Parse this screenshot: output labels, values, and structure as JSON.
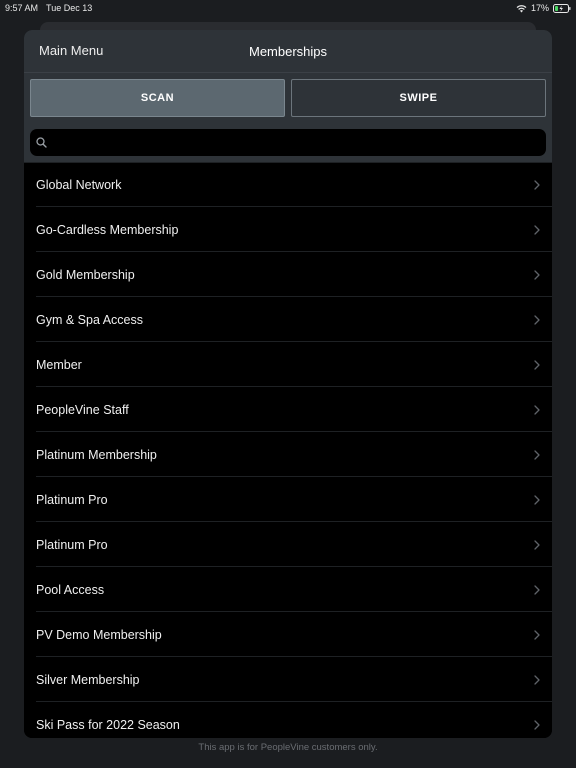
{
  "status_bar": {
    "time": "9:57 AM",
    "date": "Tue Dec 13",
    "battery": "17%"
  },
  "nav": {
    "back_label": "Main Menu",
    "title": "Memberships"
  },
  "segments": {
    "scan_label": "SCAN",
    "swipe_label": "SWIPE",
    "selected": "SCAN"
  },
  "search": {
    "value": "",
    "placeholder": ""
  },
  "list": {
    "items": [
      {
        "label": "Global Network"
      },
      {
        "label": "Go-Cardless Membership"
      },
      {
        "label": "Gold Membership"
      },
      {
        "label": "Gym & Spa Access"
      },
      {
        "label": "Member"
      },
      {
        "label": "PeopleVine Staff"
      },
      {
        "label": "Platinum Membership"
      },
      {
        "label": "Platinum Pro"
      },
      {
        "label": "Platinum Pro"
      },
      {
        "label": "Pool Access"
      },
      {
        "label": "PV Demo Membership"
      },
      {
        "label": "Silver Membership"
      },
      {
        "label": "Ski Pass for 2022 Season"
      }
    ]
  },
  "footer": {
    "text": "This app is for PeopleVine customers only."
  },
  "colors": {
    "background": "#1b1d20",
    "nav_bar": "#2e3338",
    "active_segment": "#5c6870",
    "list_bg": "#000000"
  },
  "icons": {
    "wifi": "wifi-icon",
    "battery": "battery-charging-icon",
    "search": "search-icon",
    "chevron": "chevron-right-icon"
  }
}
